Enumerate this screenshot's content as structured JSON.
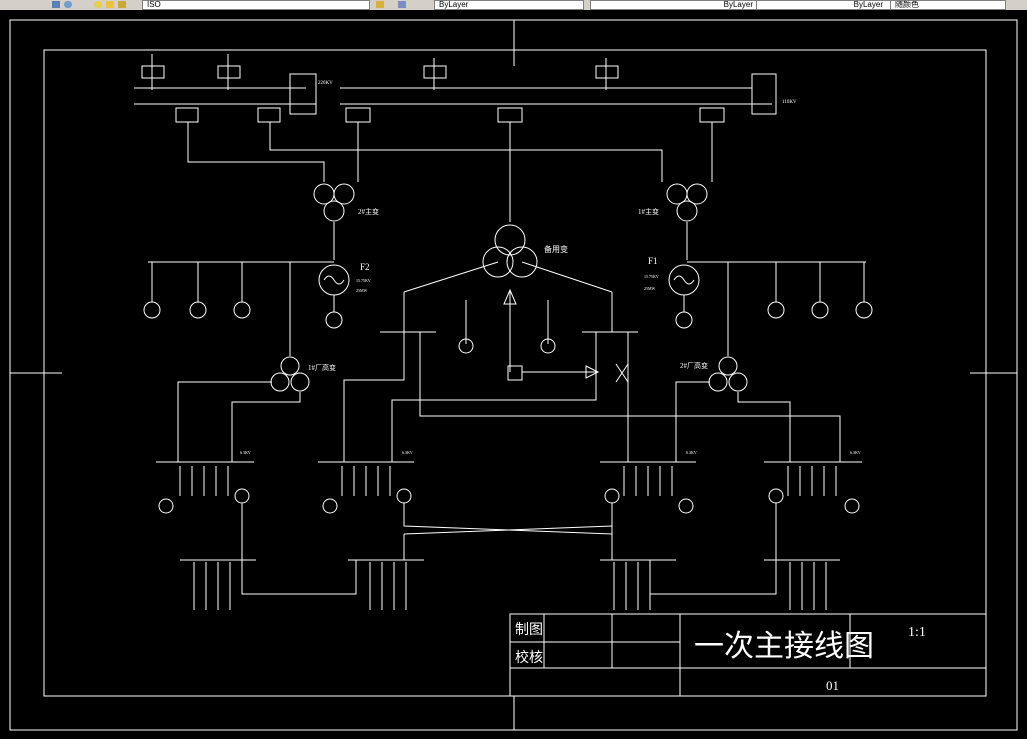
{
  "toolbar": {
    "style_value": "ISO",
    "layer_value": "ByLayer",
    "linetype_value": "ByLayer",
    "lineweight_value": "ByLayer",
    "color_value": "随颜色"
  },
  "diagram": {
    "gen_left": "F2",
    "gen_right": "F1",
    "main_transformer_left": "2#主变",
    "main_transformer_right": "1#主变",
    "standby_transformer": "备用变",
    "station_transformer_left": "1#厂高变",
    "station_transformer_right": "2#厂高变",
    "bus_left_hv": "220KV",
    "bus_right_hv": "110KV",
    "gen_left_rating_1": "15.75KV",
    "gen_left_rating_2": "25MW",
    "gen_right_rating_1": "15.75KV",
    "gen_right_rating_2": "25MW",
    "bus_6kv_1": "6.3KV",
    "bus_6kv_2": "6.3KV",
    "bus_6kv_3": "6.3KV",
    "bus_6kv_4": "6.3KV"
  },
  "title_block": {
    "drawn_label": "制图",
    "checked_label": "校核",
    "title": "一次主接线图",
    "scale": "1:1",
    "sheet": "01"
  }
}
